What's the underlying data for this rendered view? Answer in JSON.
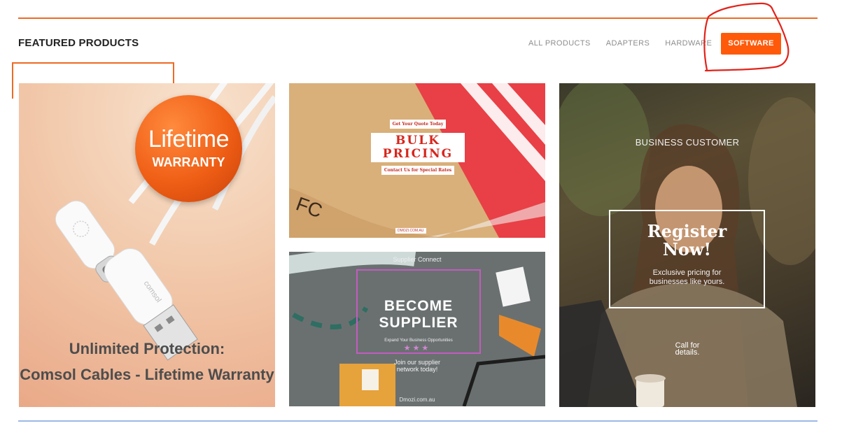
{
  "section": {
    "title": "FEATURED PRODUCTS"
  },
  "filters": {
    "items": [
      {
        "label": "ALL PRODUCTS",
        "active": false
      },
      {
        "label": "ADAPTERS",
        "active": false
      },
      {
        "label": "HARDWARE",
        "active": false
      },
      {
        "label": "SOFTWARE",
        "active": true
      }
    ]
  },
  "colors": {
    "accent": "#ff5a0a",
    "rule_top": "#ee6a24",
    "rule_bottom": "#9db8e6",
    "annotation": "#e2231a"
  },
  "cards": {
    "cable": {
      "badge_line1": "Lifetime",
      "badge_line2": "WARRANTY",
      "cable_brand": "comsol",
      "caption_line1": "Unlimited Protection:",
      "caption_line2": "Comsol Cables - Lifetime Warranty"
    },
    "bulk": {
      "tag": "Get Your Quote Today",
      "title_line1": "BULK",
      "title_line2": "PRICING",
      "subtitle": "Contact Us for Special Rates",
      "site": "DMOZI.COM.AU"
    },
    "supplier": {
      "top_label": "Supplier Connect",
      "title_line1": "BECOME",
      "title_line2": "SUPPLIER",
      "subtitle": "Expand Your Business Opportunities",
      "stars": "★★★",
      "cta_line1": "Join our supplier",
      "cta_line2": "network today!",
      "site": "Dmozi.com.au"
    },
    "business": {
      "eyebrow": "BUSINESS CUSTOMER",
      "title_line1": "Register",
      "title_line2": "Now!",
      "sub_line1": "Exclusive pricing for",
      "sub_line2": "businesses like yours.",
      "cta_line1": "Call for",
      "cta_line2": "details."
    }
  }
}
